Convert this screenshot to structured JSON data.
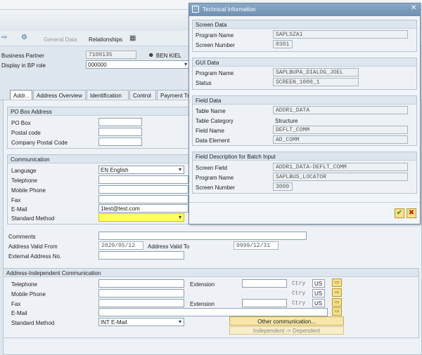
{
  "toolbar": {
    "general_data": "General Data",
    "relationships": "Relationships"
  },
  "header": {
    "bp_label": "Business Partner",
    "bp_value": "7100135",
    "bp_name": "BEN KIEL",
    "role_label": "Display in BP role",
    "role_value": "000000"
  },
  "tabs": [
    "Addr...",
    "Address Overview",
    "Identification",
    "Control",
    "Payment Tr"
  ],
  "pobox": {
    "title": "PO Box Address",
    "po_box": "PO Box",
    "postal_code": "Postal code",
    "company_postal_code": "Company Postal Code"
  },
  "communication": {
    "title": "Communication",
    "language_label": "Language",
    "language_value": "EN English",
    "telephone": "Telephone",
    "mobile": "Mobile Phone",
    "fax": "Fax",
    "email_label": "E-Mail",
    "email_value": "1test@test.com",
    "std_method": "Standard Method"
  },
  "misc": {
    "comments": "Comments",
    "valid_from_label": "Address Valid From",
    "valid_from_value": "2020/05/12",
    "valid_to_label": "Address Valid To",
    "valid_to_value": "9999/12/31",
    "external": "External Address No."
  },
  "indep": {
    "title": "Address-Independent Communication",
    "telephone": "Telephone",
    "mobile": "Mobile Phone",
    "fax": "Fax",
    "email": "E-Mail",
    "std_method": "Standard Method",
    "std_method_value": "INT E-Mail",
    "extension": "Extension",
    "ctry": "Ctry",
    "ctry_value": "US",
    "other_comm": "Other communication...",
    "indep_dep": "Independent -> Dependent"
  },
  "dialog": {
    "title": "Technical Information",
    "screen": {
      "title": "Screen Data",
      "program_label": "Program Name",
      "program_value": "SAPLSZA1",
      "number_label": "Screen Number",
      "number_value": "0301"
    },
    "gui": {
      "title": "GUI Data",
      "program_label": "Program Name",
      "program_value": "SAPLBUPA_DIALOG_JOEL",
      "status_label": "Status",
      "status_value": "SCREEN_1000_1"
    },
    "field": {
      "title": "Field Data",
      "table_label": "Table Name",
      "table_value": "ADDR1_DATA",
      "category_label": "Table Category",
      "category_value": "Structure",
      "field_label": "Field Name",
      "field_value": "DEFLT_COMM",
      "element_label": "Data Element",
      "element_value": "AD_COMM"
    },
    "batch": {
      "title": "Field Description for Batch Input",
      "screen_field_label": "Screen Field",
      "screen_field_value": "ADDR1_DATA-DEFLT_COMM",
      "program_label": "Program Name",
      "program_value": "SAPLBUS_LOCATOR",
      "number_label": "Screen Number",
      "number_value": "3000"
    }
  }
}
